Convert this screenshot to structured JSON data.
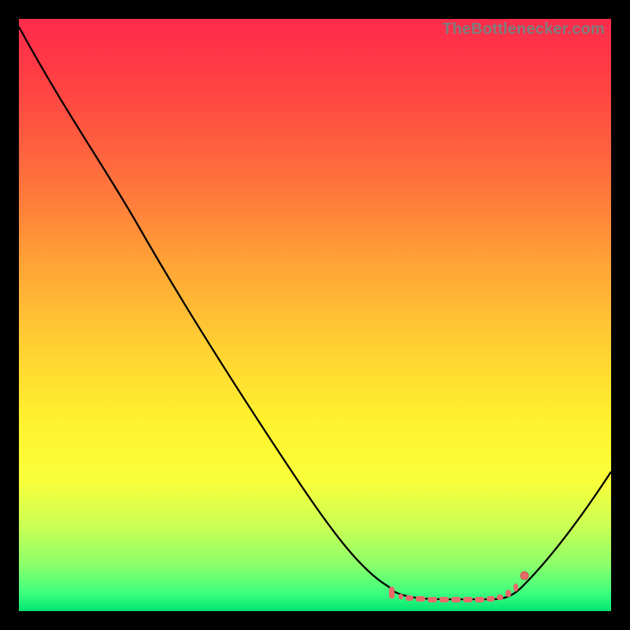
{
  "watermark": "TheBottlenecker.com",
  "chart_data": {
    "type": "line",
    "title": "",
    "xlabel": "",
    "ylabel": "",
    "xlim": [
      0,
      100
    ],
    "ylim": [
      0,
      100
    ],
    "series": [
      {
        "name": "curve",
        "x": [
          0,
          8,
          20,
          28,
          37,
          47,
          53,
          58,
          62,
          64,
          68,
          73,
          78,
          80,
          82,
          85,
          90,
          95,
          100
        ],
        "y": [
          99,
          84,
          65,
          52,
          37,
          23,
          13,
          6,
          3,
          2,
          2,
          2,
          2,
          2,
          3,
          4,
          9,
          17,
          24
        ]
      }
    ],
    "markers": {
      "name": "bottom-plateau",
      "color": "#e86a6a",
      "points": [
        {
          "x": 63,
          "y": 3
        },
        {
          "x": 65,
          "y": 2
        },
        {
          "x": 67,
          "y": 2
        },
        {
          "x": 69,
          "y": 2
        },
        {
          "x": 71,
          "y": 2
        },
        {
          "x": 73,
          "y": 2
        },
        {
          "x": 75,
          "y": 2
        },
        {
          "x": 77,
          "y": 2
        },
        {
          "x": 79,
          "y": 2
        },
        {
          "x": 81,
          "y": 2.5
        },
        {
          "x": 83,
          "y": 3.5
        },
        {
          "x": 85,
          "y": 5
        }
      ]
    },
    "background_gradient_stops": [
      {
        "pos": 0.0,
        "color": "#ff2b4b"
      },
      {
        "pos": 0.3,
        "color": "#ff7a3b"
      },
      {
        "pos": 0.56,
        "color": "#ffd232"
      },
      {
        "pos": 0.78,
        "color": "#f9ff3a"
      },
      {
        "pos": 1.0,
        "color": "#00e472"
      }
    ]
  }
}
